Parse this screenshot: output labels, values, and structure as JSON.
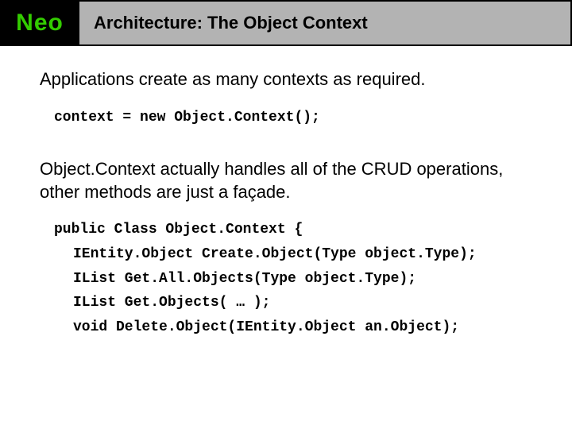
{
  "header": {
    "logo": "Neo",
    "title": "Architecture: The Object Context"
  },
  "body": {
    "para1": "Applications create as many contexts as required.",
    "code1": {
      "line1": "context = new Object.Context();"
    },
    "para2": "Object.Context actually handles all of the CRUD operations, other methods are just a façade.",
    "code2": {
      "line1": "public Class Object.Context {",
      "line2": "IEntity.Object Create.Object(Type object.Type);",
      "line3": "IList Get.All.Objects(Type object.Type);",
      "line4": "IList Get.Objects( … );",
      "line5": "void Delete.Object(IEntity.Object an.Object);"
    }
  }
}
